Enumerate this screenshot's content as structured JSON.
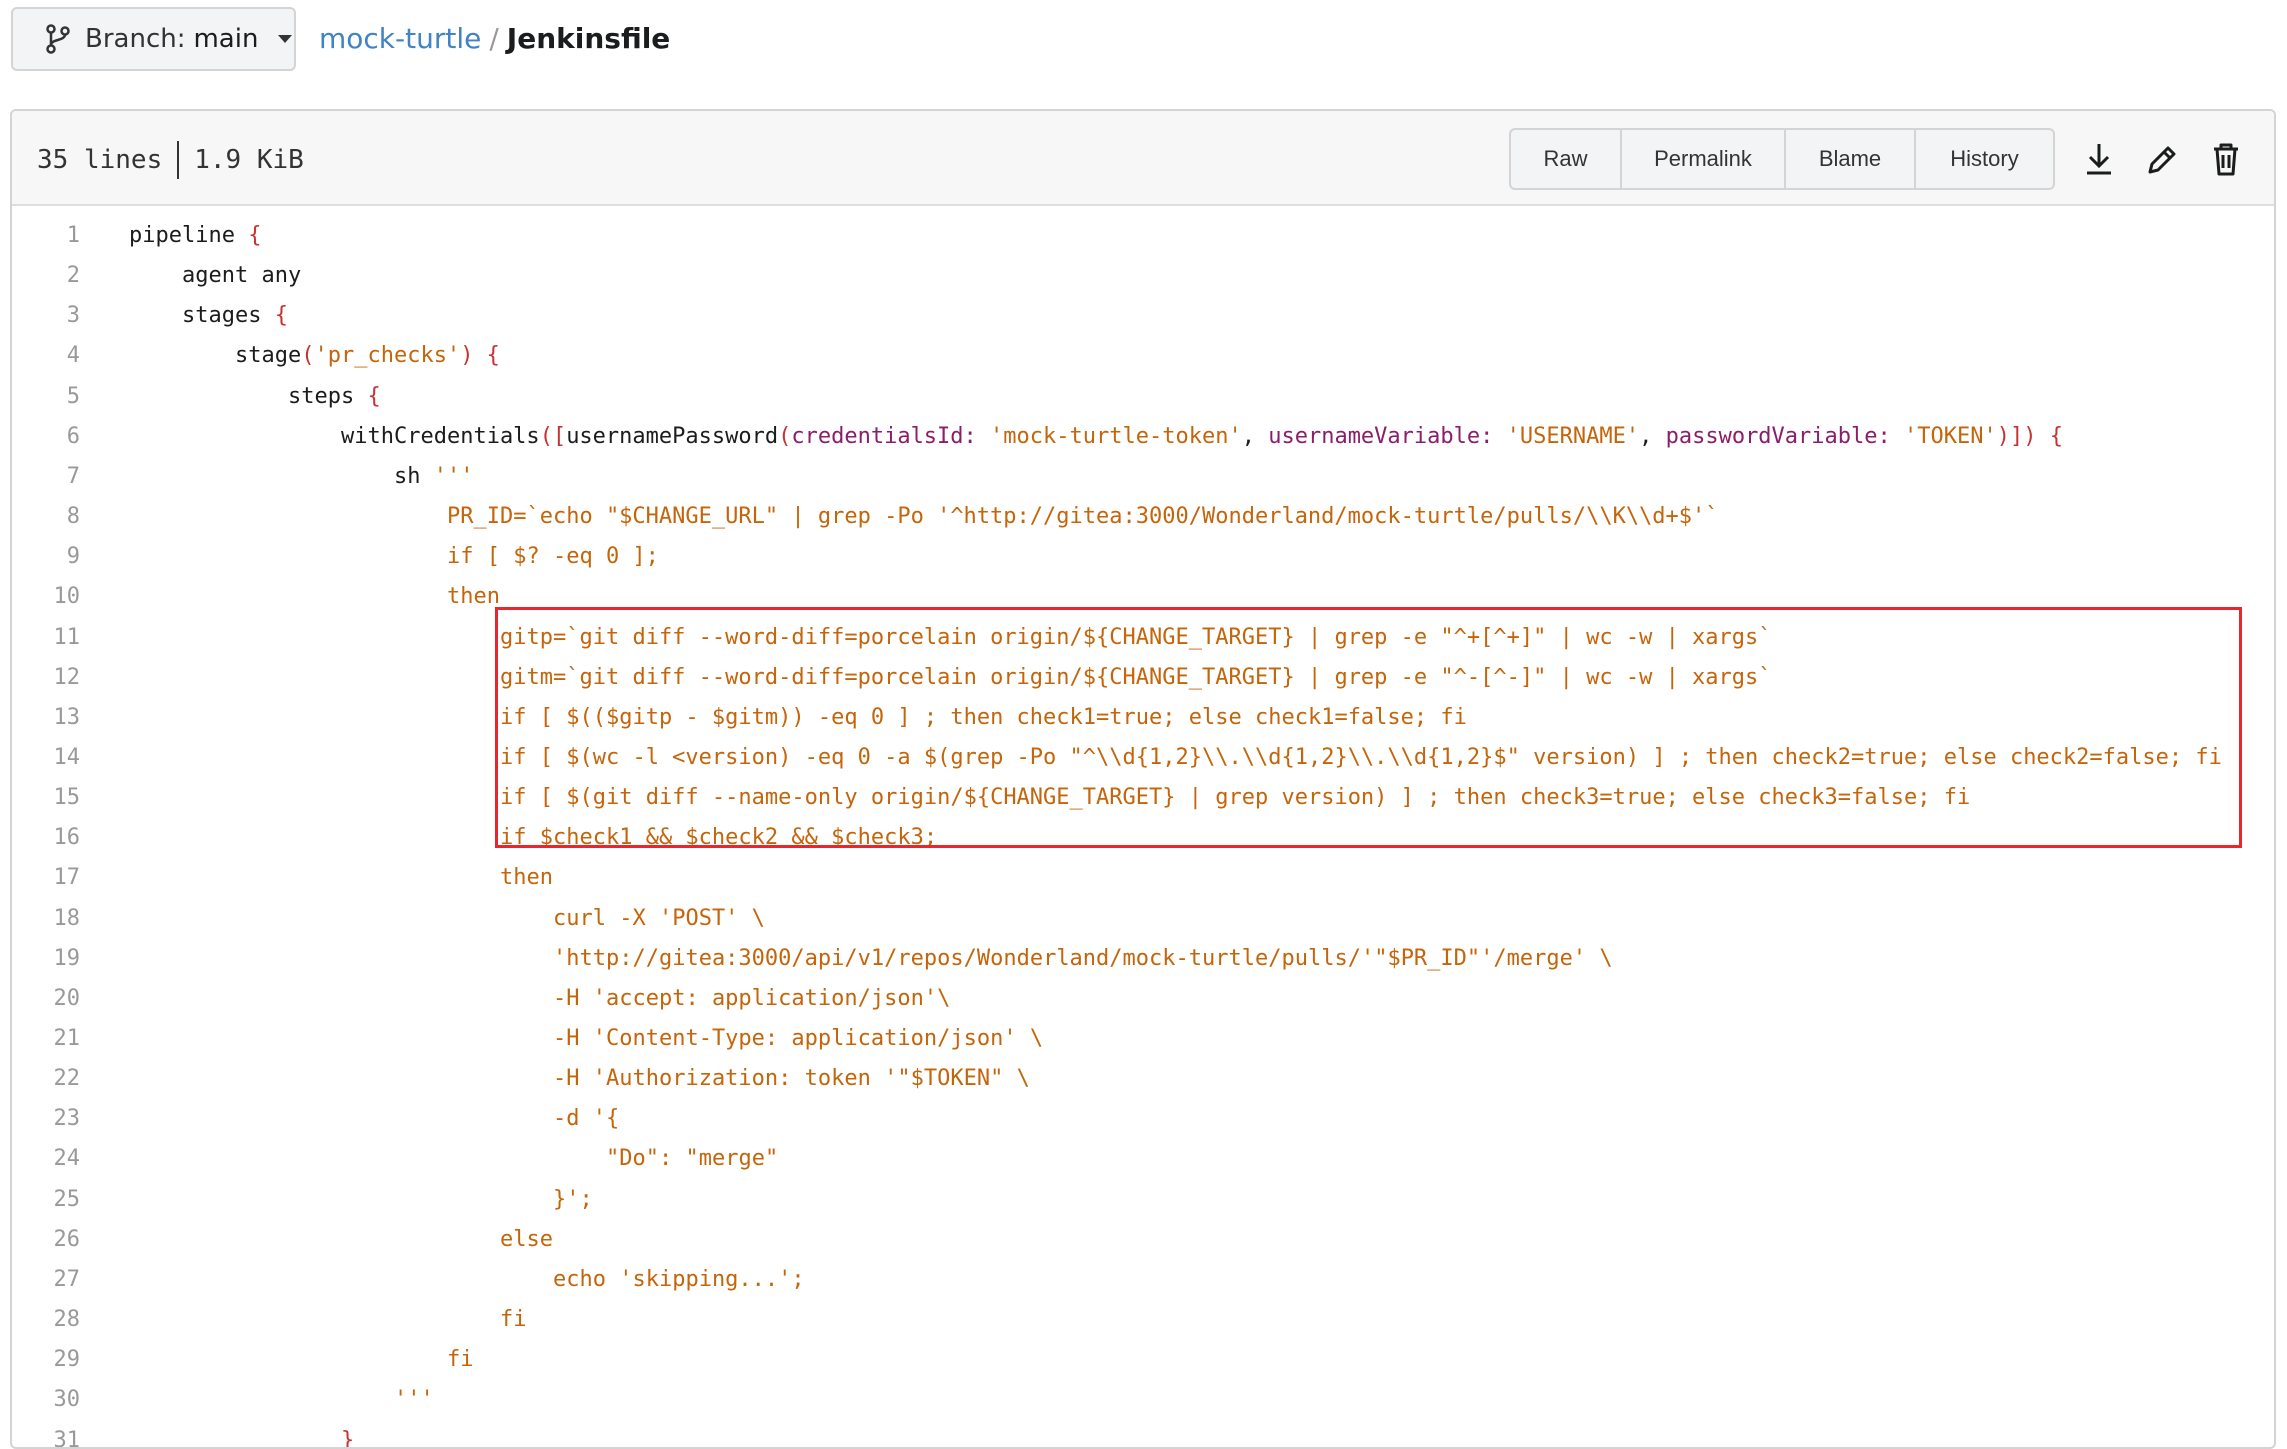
{
  "branch": {
    "prefix": "Branch:",
    "name": "main",
    "icon": "git-branch-icon"
  },
  "breadcrumb": {
    "repo": "mock-turtle",
    "separator": "/",
    "file": "Jenkinsfile"
  },
  "file_info": {
    "lines": "35 lines",
    "size": "1.9 KiB"
  },
  "buttons": {
    "raw": "Raw",
    "permalink": "Permalink",
    "blame": "Blame",
    "history": "History"
  },
  "icons": {
    "download": "download-icon",
    "edit": "pencil-icon",
    "delete": "trash-icon"
  },
  "colors": {
    "string": "#c5650b",
    "brace": "#c73232",
    "key": "#8b1e6b",
    "link": "#4183c4",
    "highlight": "#e8262c"
  },
  "code": [
    {
      "n": "1",
      "indent": 0,
      "t": [
        [
          "pipeline ",
          "p"
        ],
        [
          "{",
          "b"
        ]
      ]
    },
    {
      "n": "2",
      "indent": 1,
      "t": [
        [
          "agent any",
          "p"
        ]
      ]
    },
    {
      "n": "3",
      "indent": 1,
      "t": [
        [
          "stages ",
          "p"
        ],
        [
          "{",
          "b"
        ]
      ]
    },
    {
      "n": "4",
      "indent": 2,
      "t": [
        [
          "stage",
          "p"
        ],
        [
          "(",
          "b"
        ],
        [
          "'pr_checks'",
          "s"
        ],
        [
          ") {",
          "b"
        ]
      ]
    },
    {
      "n": "5",
      "indent": 3,
      "t": [
        [
          "steps ",
          "p"
        ],
        [
          "{",
          "b"
        ]
      ]
    },
    {
      "n": "6",
      "indent": 4,
      "t": [
        [
          "withCredentials",
          "p"
        ],
        [
          "([",
          "b"
        ],
        [
          "usernamePassword",
          "p"
        ],
        [
          "(",
          "b"
        ],
        [
          "credentialsId:",
          "k"
        ],
        [
          " ",
          "p"
        ],
        [
          "'mock-turtle-token'",
          "s"
        ],
        [
          ", ",
          "p"
        ],
        [
          "usernameVariable:",
          "k"
        ],
        [
          " ",
          "p"
        ],
        [
          "'USERNAME'",
          "s"
        ],
        [
          ", ",
          "p"
        ],
        [
          "passwordVariable:",
          "k"
        ],
        [
          " ",
          "p"
        ],
        [
          "'TOKEN'",
          "s"
        ],
        [
          ")]) {",
          "b"
        ]
      ]
    },
    {
      "n": "7",
      "indent": 5,
      "t": [
        [
          "sh ",
          "p"
        ],
        [
          "'''",
          "s"
        ]
      ]
    },
    {
      "n": "8",
      "indent": 6,
      "t": [
        [
          "PR_ID=`echo \"$CHANGE_URL\" | grep -Po '^http://gitea:3000/Wonderland/mock-turtle/pulls/\\\\K\\\\d+$'`",
          "s"
        ]
      ]
    },
    {
      "n": "9",
      "indent": 6,
      "t": [
        [
          "if [ $? -eq 0 ];",
          "s"
        ]
      ]
    },
    {
      "n": "10",
      "indent": 6,
      "t": [
        [
          "then",
          "s"
        ]
      ]
    },
    {
      "n": "11",
      "indent": 7,
      "t": [
        [
          "gitp=`git diff --word-diff=porcelain origin/${CHANGE_TARGET} | grep -e \"^+[^+]\" | wc -w | xargs`",
          "s"
        ]
      ]
    },
    {
      "n": "12",
      "indent": 7,
      "t": [
        [
          "gitm=`git diff --word-diff=porcelain origin/${CHANGE_TARGET} | grep -e \"^-[^-]\" | wc -w | xargs`",
          "s"
        ]
      ]
    },
    {
      "n": "13",
      "indent": 7,
      "t": [
        [
          "if [ $(($gitp - $gitm)) -eq 0 ] ; then check1=true; else check1=false; fi",
          "s"
        ]
      ]
    },
    {
      "n": "14",
      "indent": 7,
      "t": [
        [
          "if [ $(wc -l <version) -eq 0 -a $(grep -Po \"^\\\\d{1,2}\\\\.\\\\d{1,2}\\\\.\\\\d{1,2}$\" version) ] ; then check2=true; else check2=false; fi",
          "s"
        ]
      ]
    },
    {
      "n": "15",
      "indent": 7,
      "t": [
        [
          "if [ $(git diff --name-only origin/${CHANGE_TARGET} | grep version) ] ; then check3=true; else check3=false; fi",
          "s"
        ]
      ]
    },
    {
      "n": "16",
      "indent": 7,
      "t": [
        [
          "if $check1 && $check2 && $check3;",
          "s"
        ]
      ]
    },
    {
      "n": "17",
      "indent": 7,
      "t": [
        [
          "then",
          "s"
        ]
      ]
    },
    {
      "n": "18",
      "indent": 8,
      "t": [
        [
          "curl -X 'POST' \\",
          "s"
        ]
      ]
    },
    {
      "n": "19",
      "indent": 8,
      "t": [
        [
          "'http://gitea:3000/api/v1/repos/Wonderland/mock-turtle/pulls/'\"$PR_ID\"'/merge' \\",
          "s"
        ]
      ]
    },
    {
      "n": "20",
      "indent": 8,
      "t": [
        [
          "-H 'accept: application/json'\\",
          "s"
        ]
      ]
    },
    {
      "n": "21",
      "indent": 8,
      "t": [
        [
          "-H 'Content-Type: application/json' \\",
          "s"
        ]
      ]
    },
    {
      "n": "22",
      "indent": 8,
      "t": [
        [
          "-H 'Authorization: token '\"$TOKEN\" \\",
          "s"
        ]
      ]
    },
    {
      "n": "23",
      "indent": 8,
      "t": [
        [
          "-d '{",
          "s"
        ]
      ]
    },
    {
      "n": "24",
      "indent": 9,
      "t": [
        [
          "\"Do\": \"merge\"",
          "s"
        ]
      ]
    },
    {
      "n": "25",
      "indent": 8,
      "t": [
        [
          "}';",
          "s"
        ]
      ]
    },
    {
      "n": "26",
      "indent": 7,
      "t": [
        [
          "else",
          "s"
        ]
      ]
    },
    {
      "n": "27",
      "indent": 8,
      "t": [
        [
          "echo 'skipping...';",
          "s"
        ]
      ]
    },
    {
      "n": "28",
      "indent": 7,
      "t": [
        [
          "fi",
          "s"
        ]
      ]
    },
    {
      "n": "29",
      "indent": 6,
      "t": [
        [
          "fi",
          "s"
        ]
      ]
    },
    {
      "n": "30",
      "indent": 5,
      "t": [
        [
          "'''",
          "s"
        ]
      ]
    },
    {
      "n": "31",
      "indent": 4,
      "t": [
        [
          "}",
          "b"
        ]
      ]
    }
  ]
}
